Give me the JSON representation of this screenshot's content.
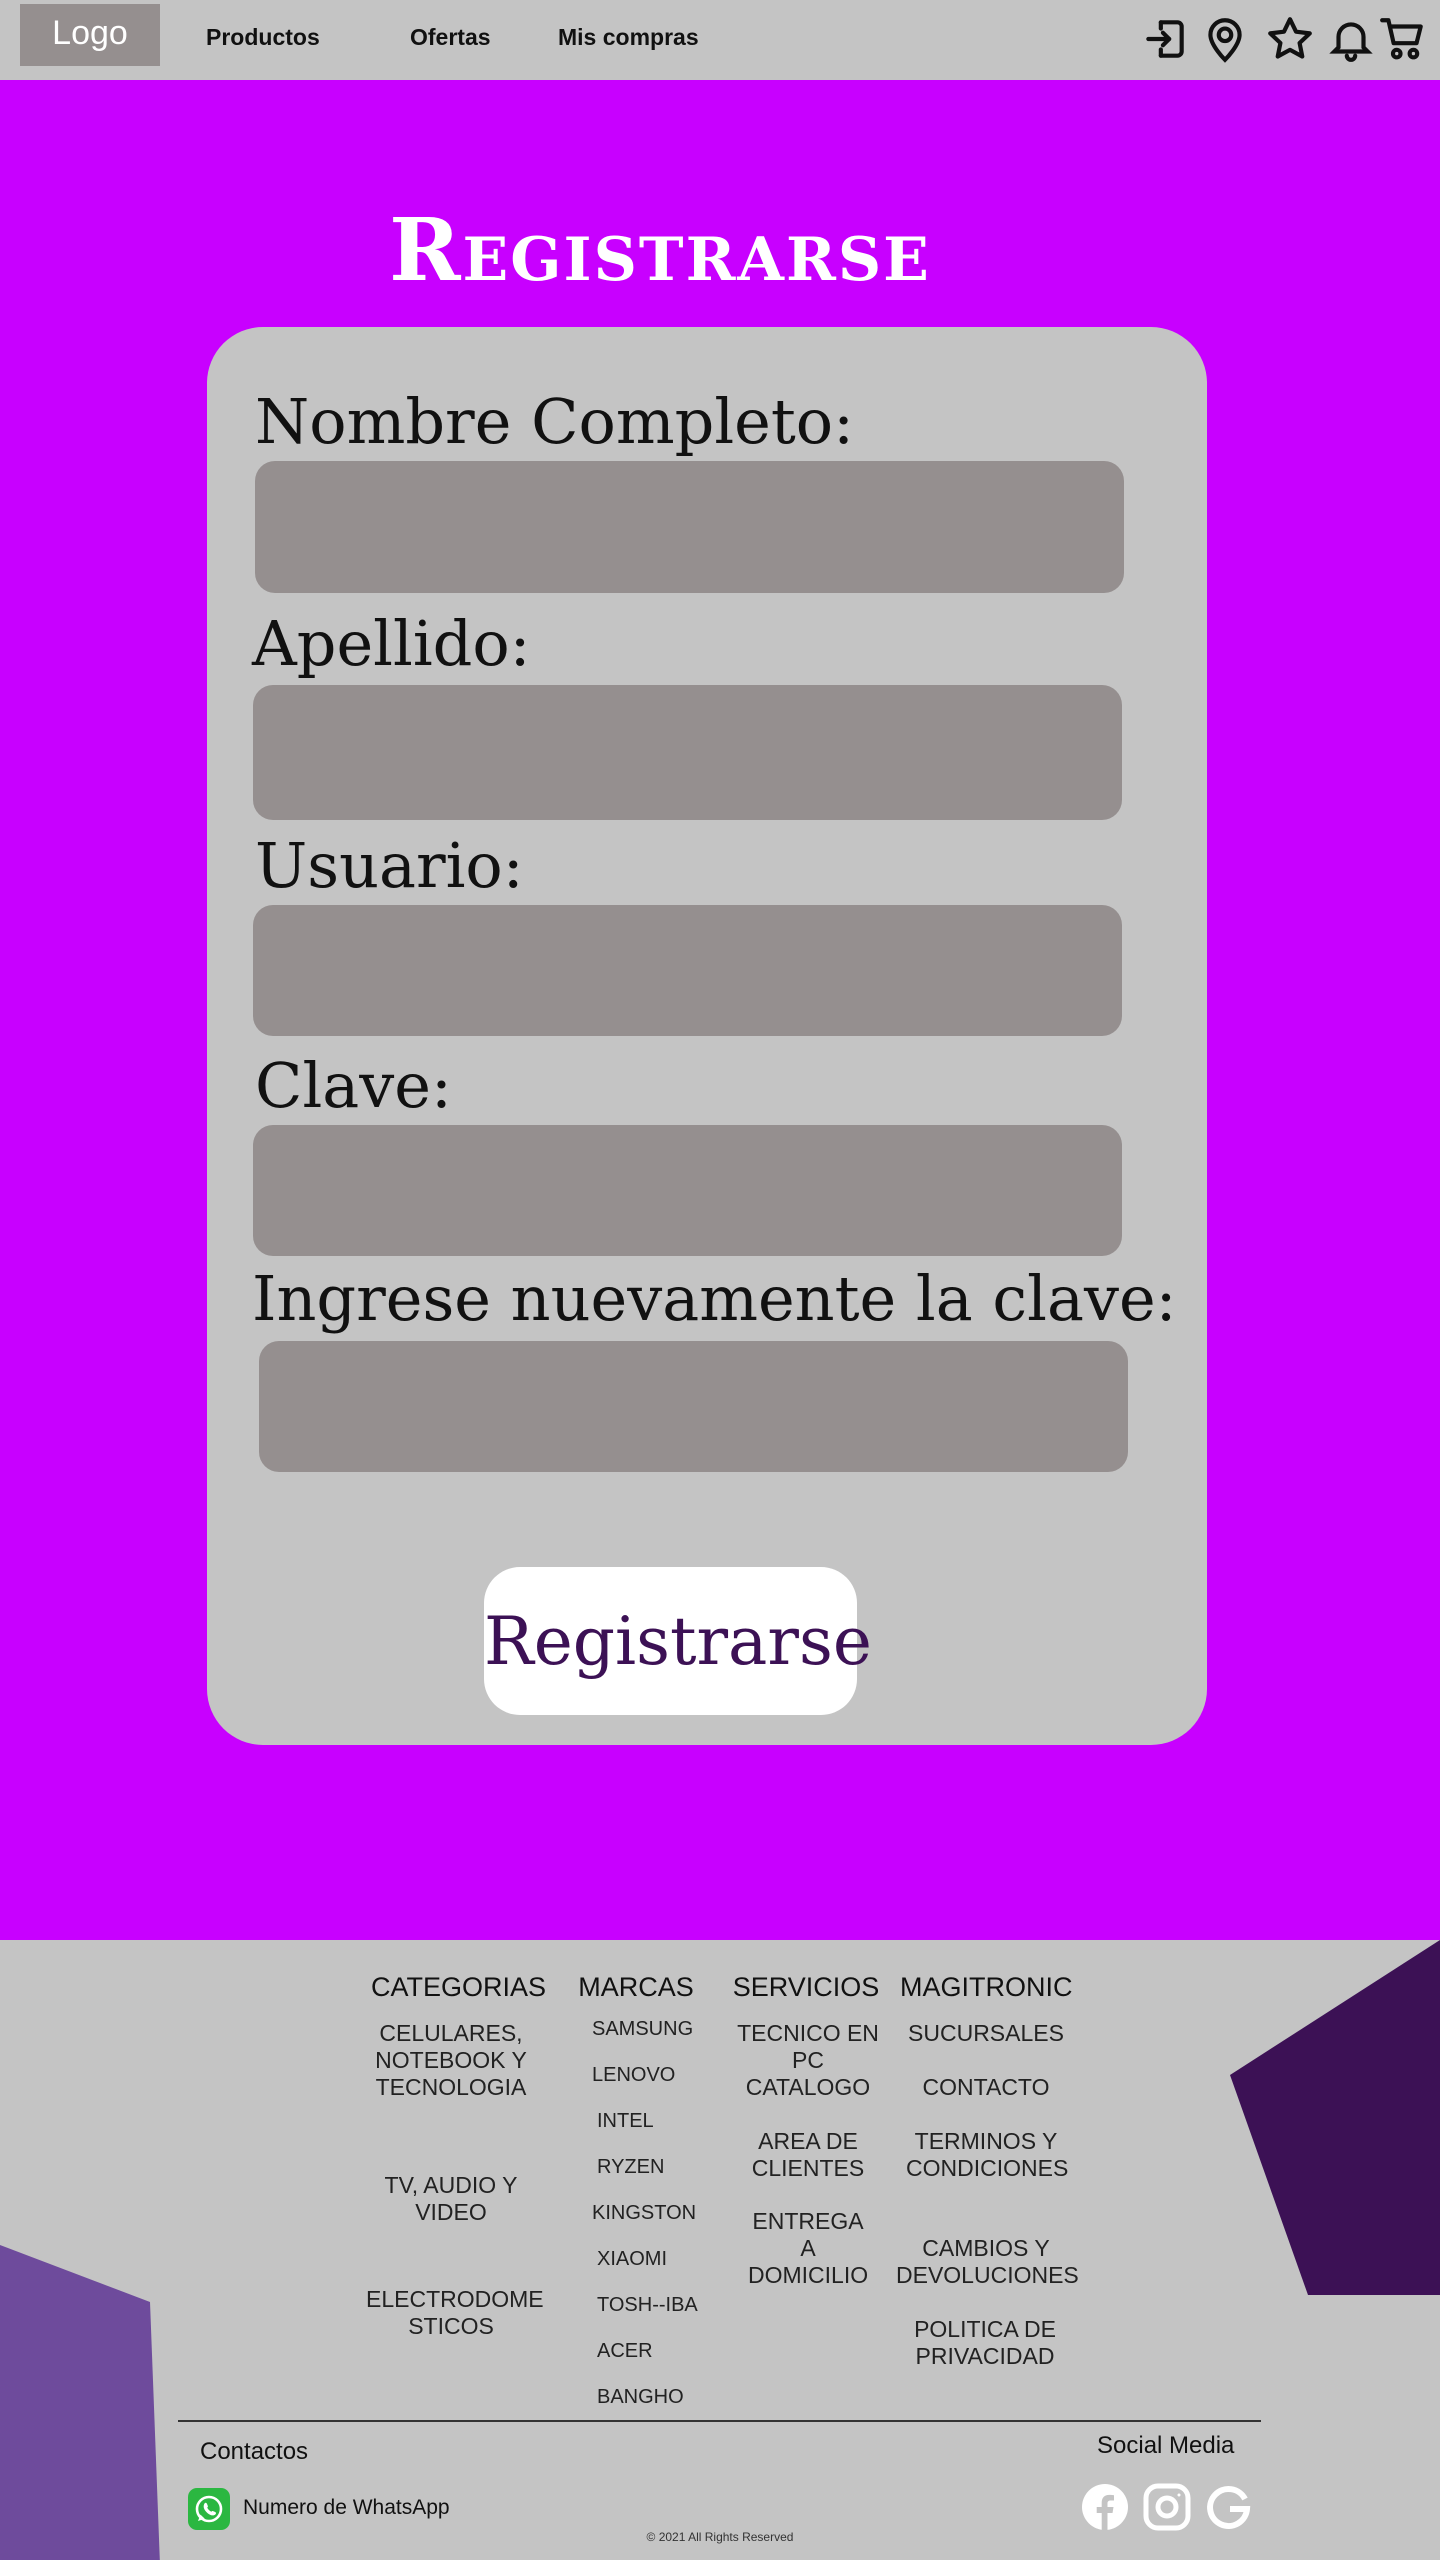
{
  "nav": {
    "logo": "Logo",
    "links": [
      "Productos",
      "Ofertas",
      "Mis compras"
    ],
    "icons": [
      "login-icon",
      "location-icon",
      "star-icon",
      "bell-icon",
      "cart-icon"
    ]
  },
  "form": {
    "title": "Registrarse",
    "fields": [
      {
        "label": "Nombre Completo:",
        "value": "",
        "placeholder": ""
      },
      {
        "label": "Apellido:",
        "value": "",
        "placeholder": ""
      },
      {
        "label": "Usuario:",
        "value": "",
        "placeholder": ""
      },
      {
        "label": "Clave:",
        "value": "",
        "placeholder": ""
      },
      {
        "label": "Ingrese nuevamente la clave:",
        "value": "",
        "placeholder": ""
      }
    ],
    "submit_label": "Registrarse"
  },
  "footer": {
    "categorias": {
      "title": "CATEGORIAS",
      "items": [
        "CELULARES, NOTEBOOK Y TECNOLOGIA",
        "TV, AUDIO Y VIDEO",
        "ELECTRODOME STICOS"
      ]
    },
    "marcas": {
      "title": "MARCAS",
      "items": [
        "SAMSUNG",
        "LENOVO",
        "INTEL",
        "RYZEN",
        "KINGSTON",
        "XIAOMI",
        "TOSH--IBA",
        "ACER",
        "BANGHO"
      ]
    },
    "servicios": {
      "title": "SERVICIOS",
      "items": [
        "TECNICO EN PC",
        "CATALOGO",
        "AREA DE CLIENTES",
        "ENTREGA A DOMICILIO"
      ]
    },
    "magitronic": {
      "title": "MAGITRONIC",
      "items": [
        "SUCURSALES",
        "CONTACTO",
        "TERMINOS Y CONDICIONES",
        "CAMBIOS Y DEVOLUCIONES",
        "POLITICA DE PRIVACIDAD"
      ]
    },
    "contactos": "Contactos",
    "whatsapp": "Numero de WhatsApp",
    "social_title": "Social Media",
    "copyright": "© 2021 All Rights Reserved"
  },
  "colors": {
    "background": "#c800ff",
    "panel": "#c4c4c4",
    "input": "#958f8f",
    "accent_dark": "#3c1155",
    "accent_mid": "#6e4b9c"
  }
}
